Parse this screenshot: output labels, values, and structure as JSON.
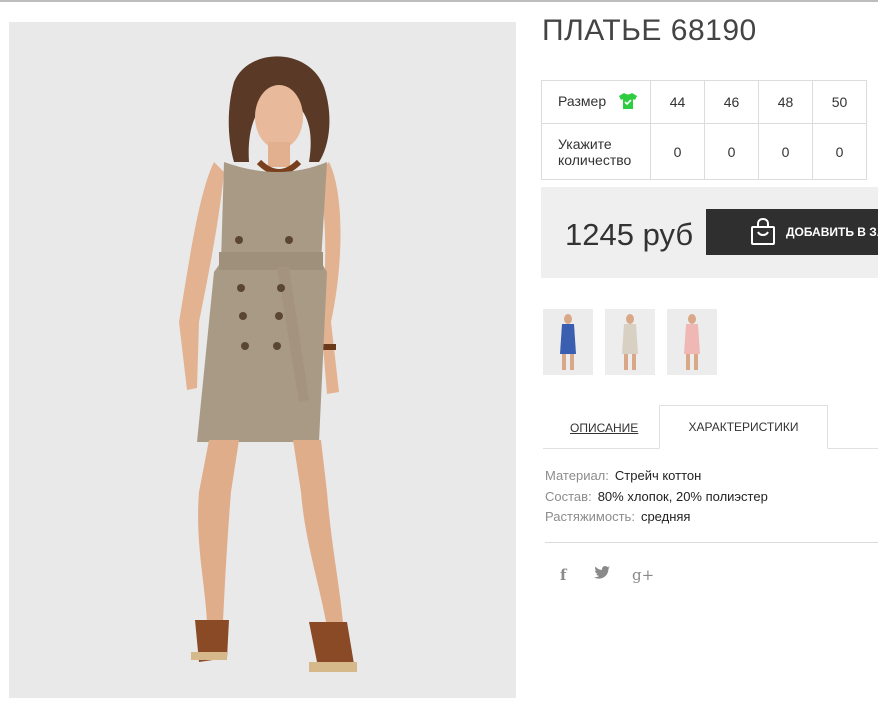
{
  "product": {
    "title": "ПЛАТЬЕ 68190",
    "price": "1245 руб",
    "add_to_cart_label": "ДОБАВИТЬ В ЗА"
  },
  "size_table": {
    "size_label": "Размер",
    "qty_label_line1": "Укажите",
    "qty_label_line2": "количество",
    "sizes": [
      "44",
      "46",
      "48",
      "50"
    ],
    "quantities": [
      "0",
      "0",
      "0",
      "0"
    ]
  },
  "thumbnails": [
    {
      "dress_color": "#3a5fb0"
    },
    {
      "dress_color": "#d9d0c4"
    },
    {
      "dress_color": "#f0b8b4"
    }
  ],
  "tabs": {
    "description": "ОПИСАНИЕ",
    "characteristics": "ХАРАКТЕРИСТИКИ"
  },
  "characteristics": [
    {
      "key": "Материал:",
      "value": "Стрейч коттон"
    },
    {
      "key": "Состав:",
      "value": "80% хлопок, 20% полиэстер"
    },
    {
      "key": "Растяжимость:",
      "value": "средняя"
    }
  ],
  "social": {
    "facebook": "f",
    "twitter": "🐦",
    "googleplus": "g+"
  },
  "colors": {
    "dress": "#a99a85",
    "button_bg": "#2f2f2f",
    "size_icon": "#2ecc40",
    "price_box_bg": "#efefef"
  }
}
